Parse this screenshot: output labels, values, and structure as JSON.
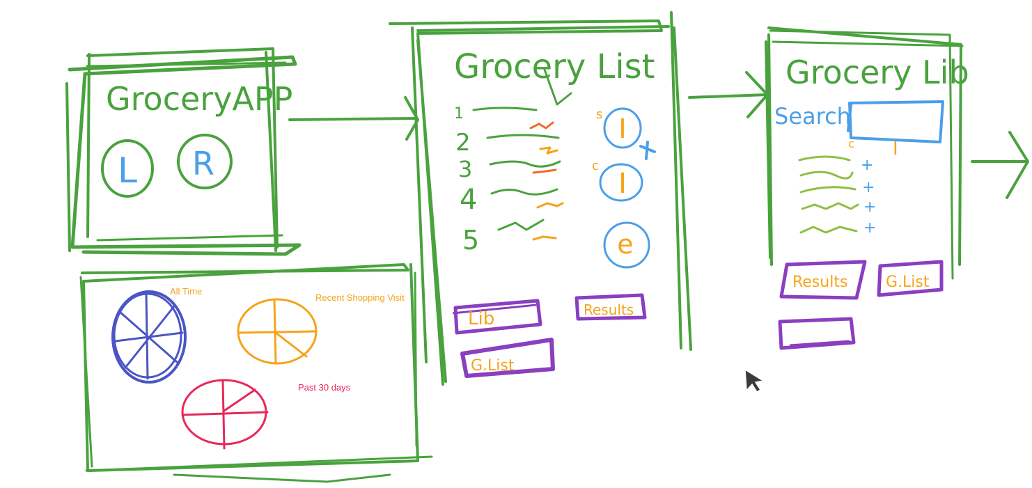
{
  "sketch": {
    "home": {
      "title": "GroceryAPP",
      "button_left": "L",
      "button_right": "R"
    },
    "stats": {
      "label_all_time": "All Time",
      "label_recent": "Recent Shopping Visit",
      "label_past": "Past 30 days"
    },
    "list": {
      "title": "Grocery List",
      "numbers": [
        "1",
        "2",
        "3",
        "4",
        "5"
      ],
      "badge_s": "s",
      "badge_c": "c",
      "circle_1": "I",
      "circle_2": "I",
      "circle_3": "e",
      "btn_lib": "Lib",
      "btn_results": "Results",
      "btn_glist": "G.List"
    },
    "library": {
      "title": "Grocery Lib",
      "search_label": "Search",
      "small_c": "c",
      "small_i": "I",
      "plus": "+",
      "btn_results": "Results",
      "btn_glist": "G.List"
    }
  },
  "colors": {
    "frame": "#4aa23e",
    "blue": "#4a9fe8",
    "orange": "#f5a31a",
    "purple": "#8a3fc0",
    "navy": "#4956c4",
    "pink": "#e8285a"
  },
  "icons": {
    "cursor": "mouse-pointer-icon"
  }
}
